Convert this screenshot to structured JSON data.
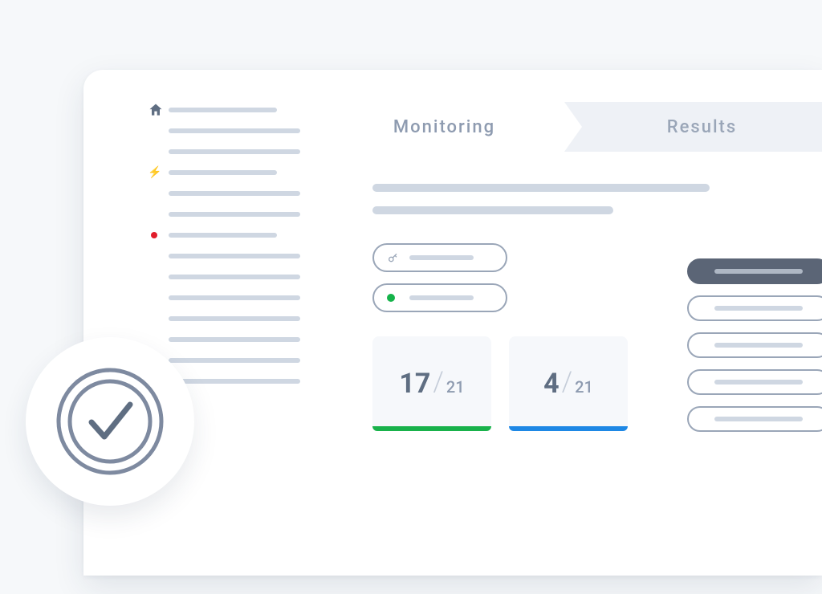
{
  "tabs": {
    "active": "Monitoring",
    "inactive": "Results"
  },
  "sidebar": {
    "item_count": 14,
    "alerts": {
      "bolt_index": 3,
      "red_index": 6
    }
  },
  "filters": {
    "key_label": "",
    "status_label": ""
  },
  "stats": {
    "card1": {
      "value": "17",
      "total": "21"
    },
    "card2": {
      "value": "4",
      "total": "21"
    }
  },
  "pill_list": {
    "items": [
      "",
      "",
      "",
      "",
      ""
    ],
    "active_index": 0
  }
}
